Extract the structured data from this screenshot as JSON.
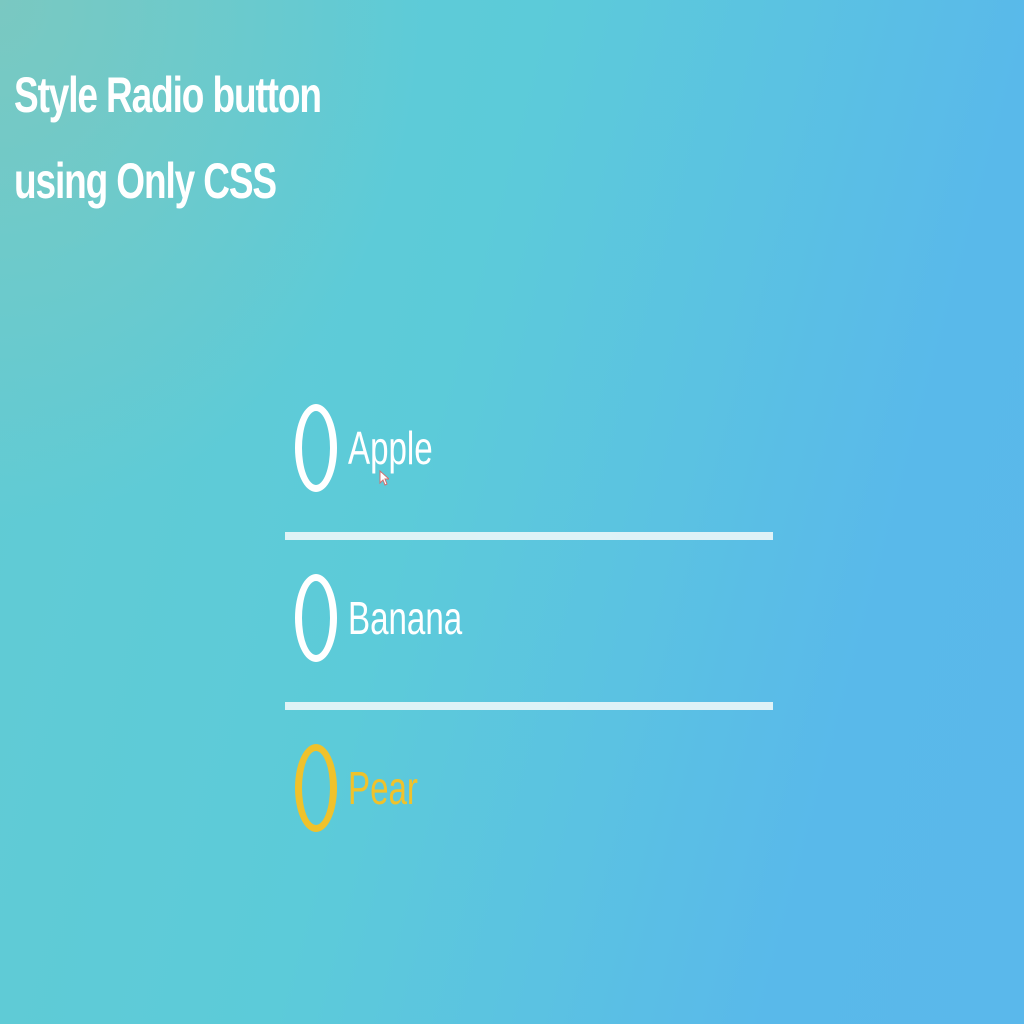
{
  "header": {
    "title_line1": "Style Radio button",
    "title_line2": "using Only CSS"
  },
  "radio_group": {
    "options": [
      {
        "label": "Apple",
        "selected": false,
        "hover": false
      },
      {
        "label": "Banana",
        "selected": false,
        "hover": false
      },
      {
        "label": "Pear",
        "selected": false,
        "hover": true
      }
    ]
  },
  "colors": {
    "text": "#ffffff",
    "accent": "#f0c22b",
    "background_start": "#62cbd3",
    "background_end": "#5ab8eb"
  },
  "icons": {
    "cursor": "mouse-pointer-icon"
  }
}
